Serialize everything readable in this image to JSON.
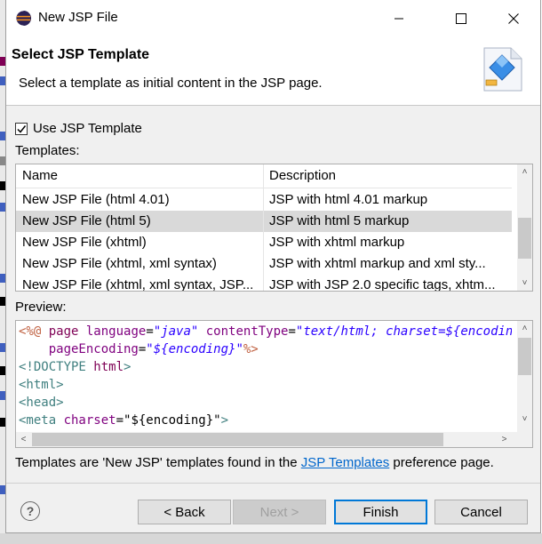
{
  "window": {
    "title": "New JSP File",
    "minimize_icon": "minimize-icon",
    "maximize_icon": "maximize-icon",
    "close_icon": "close-icon"
  },
  "banner": {
    "title": "Select JSP Template",
    "description": "Select a template as initial content in the JSP page.",
    "icon": "jsp-file-wizard-icon"
  },
  "use_template": {
    "label": "Use JSP Template",
    "checked": true
  },
  "templates": {
    "label": "Templates:",
    "columns": [
      "Name",
      "Description"
    ],
    "rows": [
      {
        "name": "New JSP File (html 4.01)",
        "description": "JSP with html 4.01 markup",
        "selected": false
      },
      {
        "name": "New JSP File (html 5)",
        "description": "JSP with html 5 markup",
        "selected": true
      },
      {
        "name": "New JSP File (xhtml)",
        "description": "JSP with xhtml markup",
        "selected": false
      },
      {
        "name": "New JSP File (xhtml, xml syntax)",
        "description": "JSP with xhtml markup and xml sty...",
        "selected": false
      },
      {
        "name": "New JSP File (xhtml, xml syntax, JSP...",
        "description": "JSP with JSP 2.0 specific tags, xhtm...",
        "selected": false
      }
    ]
  },
  "preview": {
    "label": "Preview:",
    "lines": [
      [
        {
          "t": "<%@ ",
          "c": "brown"
        },
        {
          "t": "page ",
          "c": "purple"
        },
        {
          "t": "language",
          "c": "attr"
        },
        {
          "t": "=",
          "c": ""
        },
        {
          "t": "\"java\"",
          "c": "blue-it"
        },
        {
          "t": " contentType",
          "c": "attr"
        },
        {
          "t": "=",
          "c": ""
        },
        {
          "t": "\"text/html; charset=${encoding}\"",
          "c": "blue-it"
        }
      ],
      [
        {
          "t": "    pageEncoding",
          "c": "attr"
        },
        {
          "t": "=",
          "c": ""
        },
        {
          "t": "\"${encoding}\"",
          "c": "blue-it"
        },
        {
          "t": "%>",
          "c": "brown"
        }
      ],
      [
        {
          "t": "<!DOCTYPE ",
          "c": "teal"
        },
        {
          "t": "html",
          "c": "purple"
        },
        {
          "t": ">",
          "c": "teal"
        }
      ],
      [
        {
          "t": "<html>",
          "c": "teal"
        }
      ],
      [
        {
          "t": "<head>",
          "c": "teal"
        }
      ],
      [
        {
          "t": "<meta ",
          "c": "teal"
        },
        {
          "t": "charset",
          "c": "attr"
        },
        {
          "t": "=\"${encoding}\"",
          "c": ""
        },
        {
          "t": ">",
          "c": "teal"
        }
      ]
    ]
  },
  "footer": {
    "text_before": "Templates are 'New JSP' templates found in the ",
    "link": "JSP Templates",
    "text_after": " preference page."
  },
  "buttons": {
    "help_icon": "help-icon",
    "back": "< Back",
    "next": "Next >",
    "finish": "Finish",
    "cancel": "Cancel"
  }
}
